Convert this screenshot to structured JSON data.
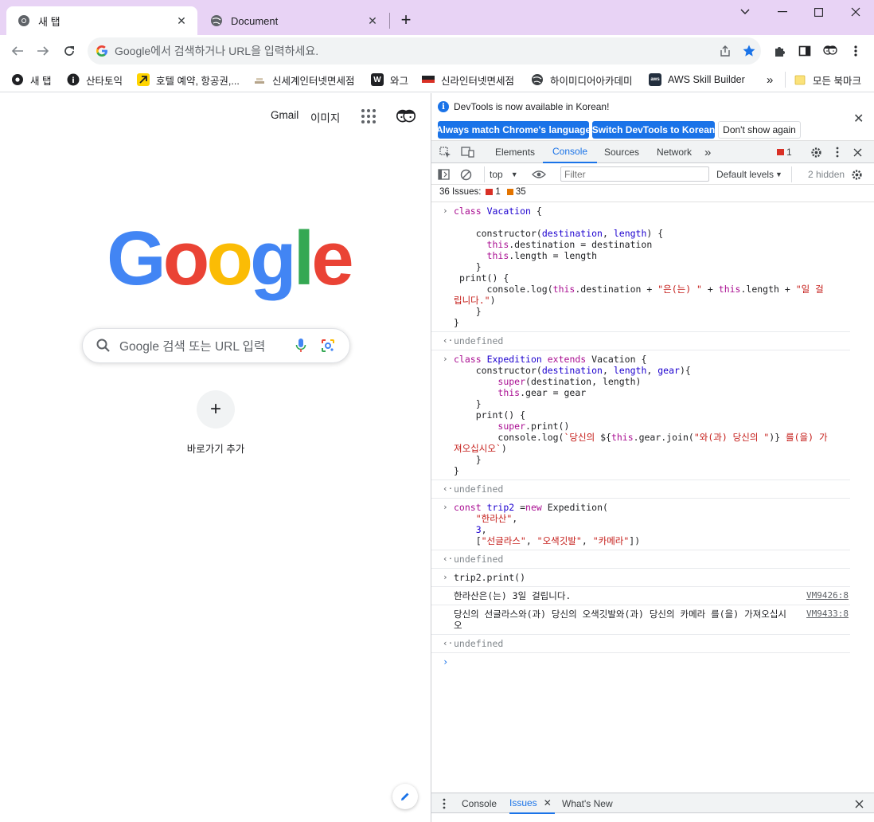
{
  "browser": {
    "tabs": [
      {
        "title": "새 탭",
        "active": true
      },
      {
        "title": "Document",
        "active": false
      }
    ],
    "new_tab_symbol": "+",
    "window_controls": [
      "chevron-down-icon",
      "minimize-icon",
      "maximize-icon",
      "close-icon"
    ],
    "omnibox": {
      "placeholder": "Google에서 검색하거나 URL을 입력하세요."
    },
    "bookmarks": [
      {
        "label": "새 탭",
        "icon": "chrome-icon"
      },
      {
        "label": "산타토익",
        "icon": "santa-icon"
      },
      {
        "label": "호텔 예약, 항공권,...",
        "icon": "arrow-icon"
      },
      {
        "label": "신세계인터넷면세점",
        "icon": "shinsegae-icon"
      },
      {
        "label": "와그",
        "icon": "waug-icon"
      },
      {
        "label": "신라인터넷면세점",
        "icon": "shilla-icon"
      },
      {
        "label": "하이미디어아카데미",
        "icon": "globe-icon"
      },
      {
        "label": "AWS Skill Builder",
        "icon": "aws-icon"
      }
    ],
    "bookmarks_overflow": "»",
    "all_bookmarks": "모든 북마크"
  },
  "ntp": {
    "gmail": "Gmail",
    "images": "이미지",
    "logo": [
      "G",
      "o",
      "o",
      "g",
      "l",
      "e"
    ],
    "logo_colors": [
      "#4285f4",
      "#ea4335",
      "#fbbc05",
      "#4285f4",
      "#34a853",
      "#ea4335"
    ],
    "search_placeholder": "Google 검색 또는 URL 입력",
    "shortcut_add_symbol": "+",
    "shortcut_add_label": "바로가기 추가"
  },
  "devtools": {
    "infobar": {
      "message": "DevTools is now available in Korean!",
      "btn_match": "Always match Chrome's language",
      "btn_switch": "Switch DevTools to Korean",
      "btn_dont_show": "Don't show again"
    },
    "tabs": [
      "Elements",
      "Console",
      "Sources",
      "Network"
    ],
    "active_tab": "Console",
    "more_tabs": "»",
    "error_count": "1",
    "console_toolbar": {
      "context": "top",
      "filter_placeholder": "Filter",
      "levels": "Default levels",
      "hidden": "2 hidden"
    },
    "issues": {
      "label": "36 Issues:",
      "errors": "1",
      "warnings": "35"
    },
    "drawer_tabs": [
      "Console",
      "Issues",
      "What's New"
    ],
    "drawer_active": "Issues"
  },
  "console": {
    "undefined": "undefined",
    "log1": "한라산은(는) 3일 걸립니다.",
    "log1_src": "VM9426:8",
    "log2": "당신의 선글라스와(과) 당신의 오색깃발와(과) 당신의 카메라 를(을) 가져오십시오",
    "log2_src": "VM9433:8",
    "cmd4": "trip2.print()",
    "prompt": "›"
  },
  "colors": {
    "titlebar": "#e8d3f5",
    "accent": "#1a73e8"
  }
}
